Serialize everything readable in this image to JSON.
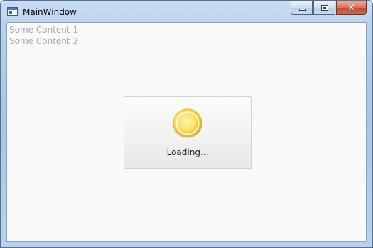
{
  "window": {
    "title": "MainWindow",
    "app_icon": "window-app-icon",
    "caption_buttons": {
      "minimize_icon": "minimize-icon",
      "maximize_icon": "maximize-icon",
      "close_icon": "close-icon",
      "close_glyph": "✕",
      "close_color": "#c9553c"
    }
  },
  "content": {
    "lines": [
      "Some Content 1",
      "Some Content 2"
    ]
  },
  "loading": {
    "label": "Loading...",
    "spinner_icon": "loading-spinner-icon",
    "spinner_color": "#f7cd3c"
  }
}
